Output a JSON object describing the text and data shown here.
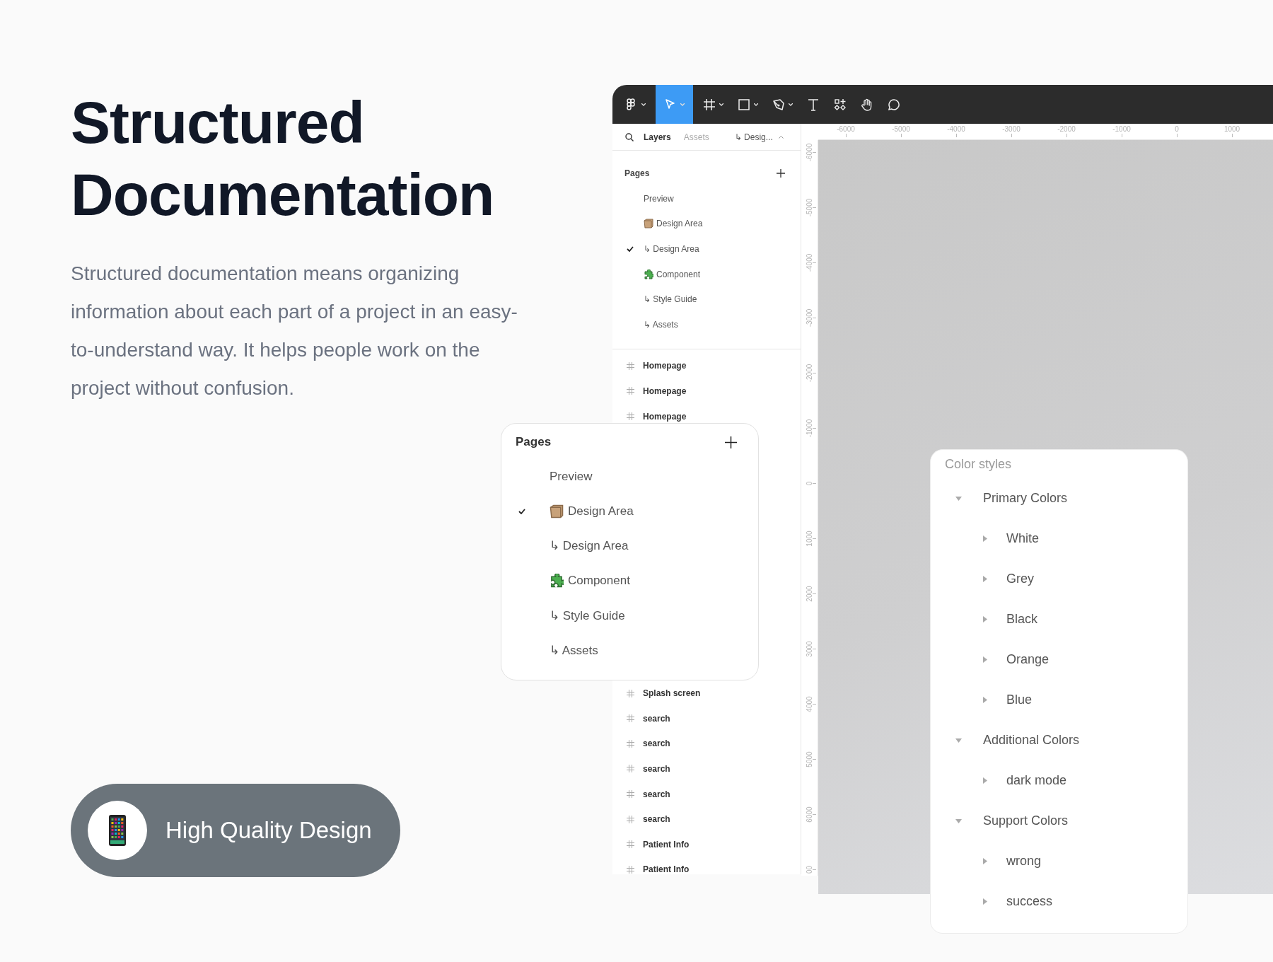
{
  "hero": {
    "title": "Structured Documentation",
    "text": "Structured documentation means organizing information about each part of a project in an easy-to-understand way. It helps people work on the project without confusion.",
    "badge": {
      "label": "High Quality Design"
    }
  },
  "toolbar": {
    "tools": [
      {
        "kind": "logo",
        "selected": false,
        "menu": true
      },
      {
        "kind": "move",
        "selected": true,
        "menu": true
      },
      {
        "kind": "frame",
        "selected": false,
        "menu": true
      },
      {
        "kind": "shape",
        "selected": false,
        "menu": true
      },
      {
        "kind": "pen",
        "selected": false,
        "menu": true
      },
      {
        "kind": "text",
        "selected": false,
        "menu": false
      },
      {
        "kind": "components",
        "selected": false,
        "menu": false
      },
      {
        "kind": "hand",
        "selected": false,
        "menu": false
      },
      {
        "kind": "comment",
        "selected": false,
        "menu": false
      }
    ]
  },
  "sidebar": {
    "tabs": [
      {
        "label": "Layers",
        "selected": true
      },
      {
        "label": "Assets",
        "selected": false
      }
    ],
    "page_switcher": "↳ Desig...",
    "pages_title": "Pages",
    "pages": [
      {
        "label": "Preview",
        "kind": "plain",
        "checked": false
      },
      {
        "label": "Design Area",
        "kind": "box",
        "checked": false
      },
      {
        "label": "↳ Design Area",
        "kind": "plain",
        "checked": true
      },
      {
        "label": "Component",
        "kind": "puzzle",
        "checked": false
      },
      {
        "label": "↳ Style Guide",
        "kind": "plain",
        "checked": false
      },
      {
        "label": "↳ Assets",
        "kind": "plain",
        "checked": false
      }
    ],
    "layers": [
      "Homepage",
      "Homepage",
      "Homepage",
      "Splash screen",
      "search",
      "search",
      "search",
      "search",
      "search",
      "Patient Info",
      "Patient Info"
    ]
  },
  "rulers": {
    "horizontal": [
      "-6000",
      "-5000",
      "-4000",
      "-3000",
      "-2000",
      "-1000",
      "0",
      "1000"
    ],
    "vertical": [
      "-6000",
      "-5000",
      "-4000",
      "-3000",
      "-2000",
      "-1000",
      "0",
      "1000",
      "2000",
      "3000",
      "4000",
      "5000",
      "6000",
      "00"
    ]
  },
  "pages_popup": {
    "title": "Pages",
    "pages": [
      {
        "label": "Preview",
        "kind": "plain",
        "checked": false
      },
      {
        "label": "Design Area",
        "kind": "box",
        "checked": true
      },
      {
        "label": "↳ Design Area",
        "kind": "plain",
        "checked": false
      },
      {
        "label": "Component",
        "kind": "puzzle",
        "checked": false
      },
      {
        "label": "↳ Style Guide",
        "kind": "plain",
        "checked": false
      },
      {
        "label": "↳ Assets",
        "kind": "plain",
        "checked": false
      }
    ]
  },
  "color_styles": {
    "title": "Color styles",
    "groups": [
      {
        "label": "Primary Colors",
        "expanded": true,
        "children": [
          {
            "label": "White",
            "expanded": false
          },
          {
            "label": "Grey",
            "expanded": false
          },
          {
            "label": "Black",
            "expanded": false
          },
          {
            "label": "Orange",
            "expanded": false
          },
          {
            "label": "Blue",
            "expanded": false
          }
        ]
      },
      {
        "label": "Additional Colors",
        "expanded": true,
        "children": [
          {
            "label": "dark mode",
            "expanded": false
          }
        ]
      },
      {
        "label": "Support Colors",
        "expanded": true,
        "children": [
          {
            "label": "wrong",
            "expanded": false
          },
          {
            "label": "success",
            "expanded": false
          }
        ]
      }
    ]
  }
}
